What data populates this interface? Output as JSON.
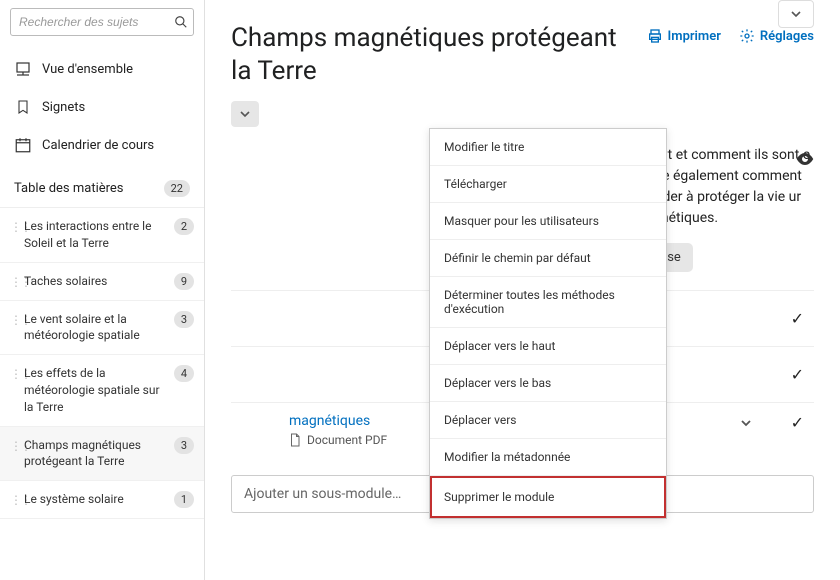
{
  "search": {
    "placeholder": "Rechercher des sujets"
  },
  "nav": {
    "overview": "Vue d'ensemble",
    "bookmarks": "Signets",
    "calendar": "Calendrier de cours"
  },
  "toc": {
    "header": "Table des matières",
    "total": "22",
    "items": [
      {
        "label": "Les interactions entre le Soleil et la Terre",
        "count": "2"
      },
      {
        "label": "Taches solaires",
        "count": "9"
      },
      {
        "label": "Le vent solaire et la météorologie spatiale",
        "count": "3"
      },
      {
        "label": "Les effets de la météorologie spatiale sur la Terre",
        "count": "4"
      },
      {
        "label": "Champs magnétiques protégeant la Terre",
        "count": "3"
      },
      {
        "label": "Le système solaire",
        "count": "1"
      }
    ]
  },
  "topbar": {
    "print": "Imprimer",
    "settings": "Réglages"
  },
  "title": "Champs magnétiques protégeant la Terre",
  "description": "ques. Il explique où ils se situent et comment ils sont e de la planète. Ce module couvre également comment 'atmosphère de la Terre pour aider à protéger la vie ur le déplacement des pôles magnétiques.",
  "dropdown": {
    "i0": "Modifier le titre",
    "i1": "Télécharger",
    "i2": "Masquer pour les utilisateurs",
    "i3": "Définir le chemin par défaut",
    "i4": "Déterminer toutes les méthodes d'exécution",
    "i5": "Déplacer vers le haut",
    "i6": "Déplacer vers le bas",
    "i7": "Déplacer vers",
    "i8": "Modifier la métadonnée",
    "i9": "Supprimer le module"
  },
  "actions": {
    "bulk": "Modification de masse"
  },
  "doc": {
    "title": "magnétiques",
    "meta": "Document PDF"
  },
  "addsub": "Ajouter un sous-module…"
}
